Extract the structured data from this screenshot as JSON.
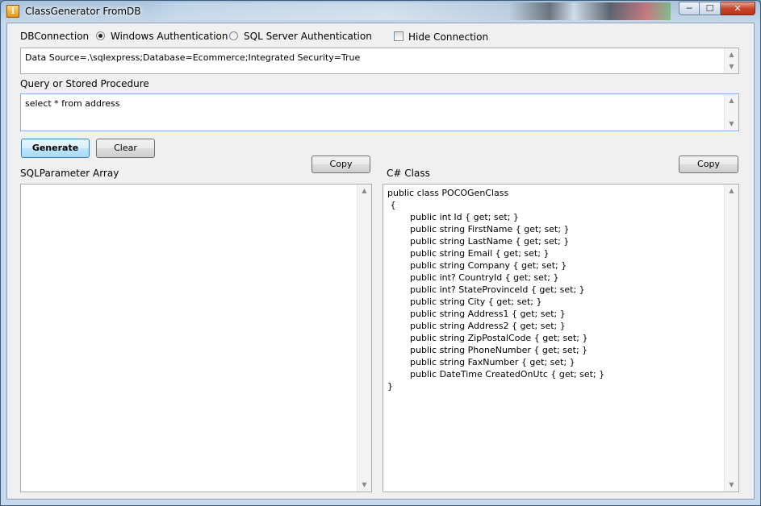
{
  "window": {
    "title": "ClassGenerator FromDB",
    "icon": "app-icon",
    "controls": {
      "minimize": "minimize-icon",
      "maximize": "maximize-icon",
      "close": "close-icon"
    }
  },
  "connection": {
    "label": "DBConnection",
    "auth_options": [
      {
        "label": "Windows Authentication",
        "selected": true
      },
      {
        "label": "SQL Server Authentication",
        "selected": false
      }
    ],
    "hide_label": "Hide Connection",
    "hide_checked": false,
    "value": "Data Source=.\\sqlexpress;Database=Ecommerce;Integrated Security=True"
  },
  "query": {
    "label": "Query or Stored Procedure",
    "value": "select * from address"
  },
  "buttons": {
    "generate": "Generate",
    "clear": "Clear"
  },
  "sql_params": {
    "label": "SQLParameter Array",
    "copy": "Copy",
    "value": ""
  },
  "csharp": {
    "label": "C# Class",
    "copy": "Copy",
    "value": "public class POCOGenClass\n {\n\t\tpublic int Id { get; set; }\n\t\tpublic string FirstName { get; set; }\n\t\tpublic string LastName { get; set; }\n\t\tpublic string Email { get; set; }\n\t\tpublic string Company { get; set; }\n\t\tpublic int? CountryId { get; set; }\n\t\tpublic int? StateProvinceId { get; set; }\n\t\tpublic string City { get; set; }\n\t\tpublic string Address1 { get; set; }\n\t\tpublic string Address2 { get; set; }\n\t\tpublic string ZipPostalCode { get; set; }\n\t\tpublic string PhoneNumber { get; set; }\n\t\tpublic string FaxNumber { get; set; }\n\t\tpublic DateTime CreatedOnUtc { get; set; }\n}"
  },
  "colors": {
    "title_bar": "#c7d9ea",
    "client_bg": "#f0f0f0",
    "focus_border": "#7eb4ea",
    "close_button": "#c9452b"
  }
}
